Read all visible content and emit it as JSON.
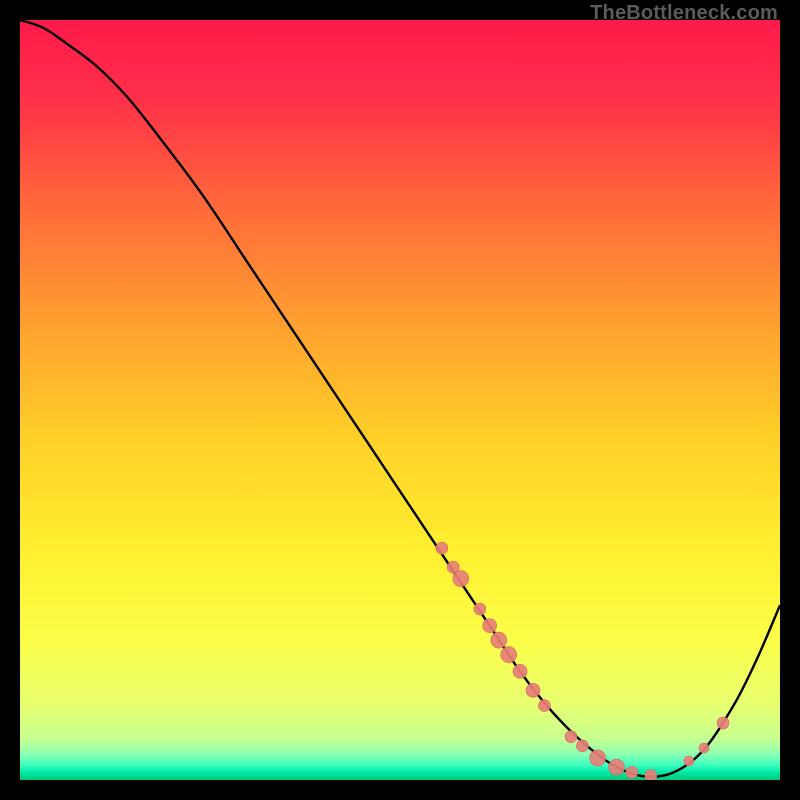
{
  "watermark": "TheBottleneck.com",
  "colors": {
    "background": "#000000",
    "gradient_stops": [
      {
        "offset": 0.0,
        "color": "#ff1a4b"
      },
      {
        "offset": 0.1,
        "color": "#ff2f49"
      },
      {
        "offset": 0.25,
        "color": "#ff6b3a"
      },
      {
        "offset": 0.4,
        "color": "#ffa030"
      },
      {
        "offset": 0.55,
        "color": "#ffd028"
      },
      {
        "offset": 0.7,
        "color": "#fff030"
      },
      {
        "offset": 0.82,
        "color": "#fbff4a"
      },
      {
        "offset": 0.9,
        "color": "#e8ff70"
      },
      {
        "offset": 0.945,
        "color": "#c8ff90"
      },
      {
        "offset": 0.965,
        "color": "#90ffb0"
      },
      {
        "offset": 0.98,
        "color": "#40ffc0"
      },
      {
        "offset": 0.99,
        "color": "#00e8a8"
      },
      {
        "offset": 1.0,
        "color": "#00c878"
      }
    ],
    "curve": "#000000",
    "marker_fill": "#e77f78",
    "marker_stroke": "#d86860"
  },
  "chart_data": {
    "type": "line",
    "title": "",
    "xlabel": "",
    "ylabel": "",
    "xlim": [
      0,
      100
    ],
    "ylim": [
      0,
      100
    ],
    "grid": false,
    "legend": false,
    "series": [
      {
        "name": "bottleneck-curve",
        "x": [
          0,
          3,
          6,
          10,
          14,
          18,
          24,
          30,
          36,
          42,
          48,
          54,
          58,
          62,
          66,
          70,
          74,
          78,
          82,
          86,
          90,
          94,
          97,
          100
        ],
        "y": [
          100,
          99,
          97,
          94,
          90,
          85,
          77,
          68,
          59,
          50,
          41,
          32,
          26,
          20,
          14,
          9,
          5,
          2,
          0.5,
          1,
          4,
          10,
          16,
          23
        ]
      }
    ],
    "markers": [
      {
        "x": 55.5,
        "y": 30.5,
        "r": 6
      },
      {
        "x": 57.0,
        "y": 28.0,
        "r": 6
      },
      {
        "x": 58.0,
        "y": 26.5,
        "r": 8
      },
      {
        "x": 60.5,
        "y": 22.5,
        "r": 6
      },
      {
        "x": 61.8,
        "y": 20.3,
        "r": 7
      },
      {
        "x": 63.0,
        "y": 18.4,
        "r": 8
      },
      {
        "x": 64.3,
        "y": 16.5,
        "r": 8
      },
      {
        "x": 65.8,
        "y": 14.3,
        "r": 7
      },
      {
        "x": 67.5,
        "y": 11.8,
        "r": 7
      },
      {
        "x": 69.0,
        "y": 9.8,
        "r": 6
      },
      {
        "x": 72.5,
        "y": 5.7,
        "r": 6
      },
      {
        "x": 74.0,
        "y": 4.5,
        "r": 6
      },
      {
        "x": 76.0,
        "y": 2.9,
        "r": 8
      },
      {
        "x": 78.5,
        "y": 1.7,
        "r": 8
      },
      {
        "x": 80.5,
        "y": 1.0,
        "r": 6
      },
      {
        "x": 83.0,
        "y": 0.6,
        "r": 6
      },
      {
        "x": 88.0,
        "y": 2.5,
        "r": 5
      },
      {
        "x": 90.0,
        "y": 4.2,
        "r": 5
      },
      {
        "x": 92.5,
        "y": 7.5,
        "r": 6
      }
    ]
  }
}
